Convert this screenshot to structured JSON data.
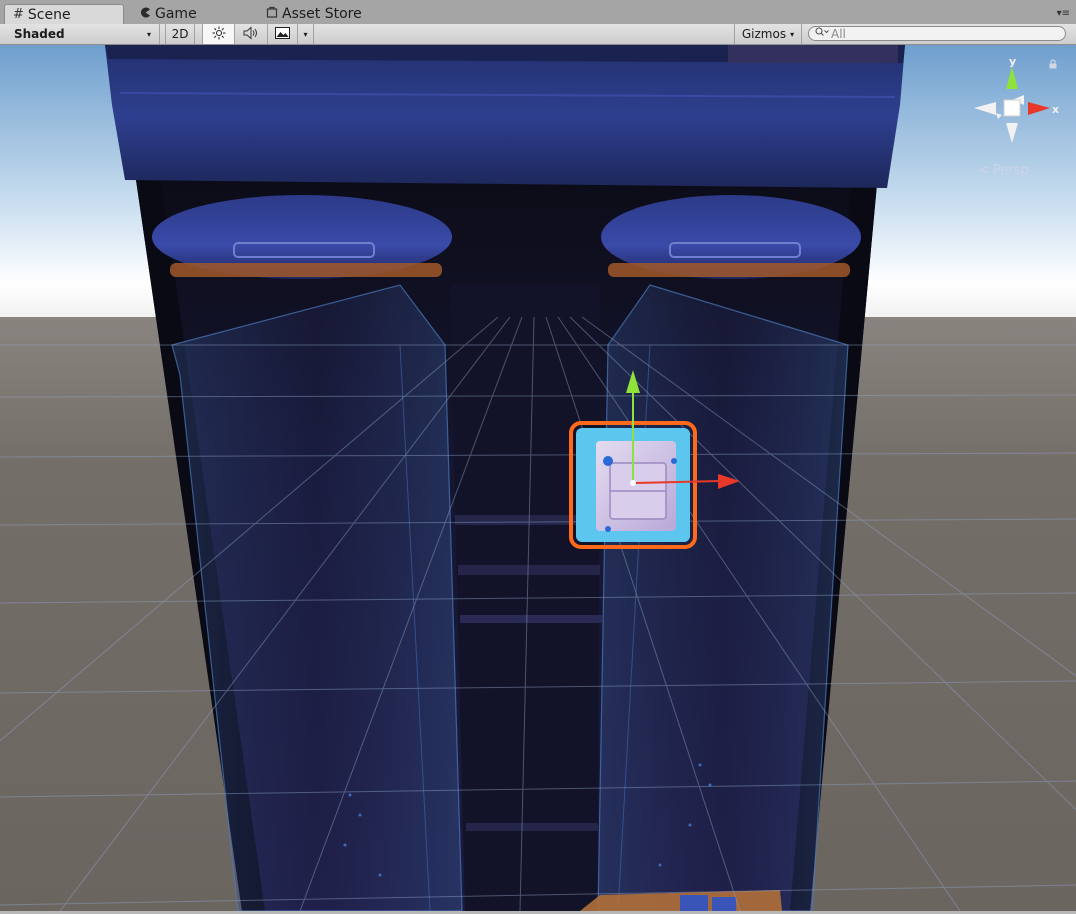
{
  "tabs": [
    {
      "label": "Scene",
      "icon": "scene-grid-icon",
      "active": true
    },
    {
      "label": "Game",
      "icon": "game-pacman-icon",
      "active": false
    },
    {
      "label": "Asset Store",
      "icon": "asset-store-bag-icon",
      "active": false
    }
  ],
  "toolbar": {
    "draw_mode": "Shaded",
    "mode_2d": "2D",
    "gizmos": "Gizmos"
  },
  "search": {
    "placeholder": "All"
  },
  "scene_gizmo": {
    "y_label": "y",
    "x_label": "x",
    "persp_label": "Persp"
  },
  "colors": {
    "tab_bar": "#a5a5a5",
    "toolbar": "#d4d4d4",
    "sky_top": "#7fb0d8",
    "horizon": "#ffffff",
    "ground": "#6a6560",
    "machine_body": "#171830",
    "machine_accent": "#2e3a8a",
    "selection_outline": "#ff6a1a",
    "axis_x": "#e8382a",
    "axis_y": "#8ee23a",
    "axis_z": "#3a6ae8"
  }
}
